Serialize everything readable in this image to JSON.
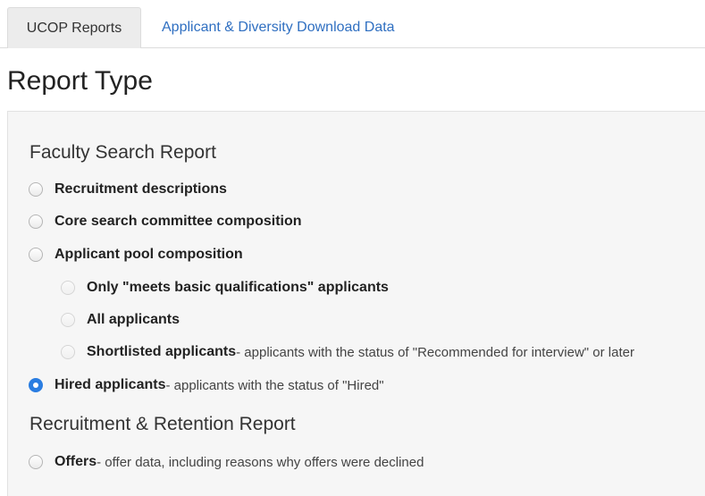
{
  "tabs": [
    {
      "label": "UCOP Reports",
      "active": true
    },
    {
      "label": "Applicant & Diversity Download Data",
      "active": false
    }
  ],
  "page_title": "Report Type",
  "sections": [
    {
      "title": "Faculty Search Report",
      "options": [
        {
          "label": "Recruitment descriptions",
          "desc": "",
          "checked": false
        },
        {
          "label": "Core search committee composition",
          "desc": "",
          "checked": false
        },
        {
          "label": "Applicant pool composition",
          "desc": "",
          "checked": false
        },
        {
          "label": "Only \"meets basic qualifications\" applicants",
          "desc": "",
          "checked": false
        },
        {
          "label": "All applicants",
          "desc": "",
          "checked": false
        },
        {
          "label": "Shortlisted applicants",
          "desc": " - applicants with the status of \"Recommended for interview\" or later",
          "checked": false
        },
        {
          "label": "Hired applicants",
          "desc": " - applicants with the status of \"Hired\"",
          "checked": true
        }
      ]
    },
    {
      "title": "Recruitment & Retention Report",
      "options": [
        {
          "label": "Offers",
          "desc": " - offer data, including reasons why offers were declined",
          "checked": false
        }
      ]
    }
  ],
  "colors": {
    "link": "#2f6fc1",
    "radio_checked": "#2a7de1",
    "panel_bg": "#f6f6f6",
    "active_tab_bg": "#ececec"
  }
}
